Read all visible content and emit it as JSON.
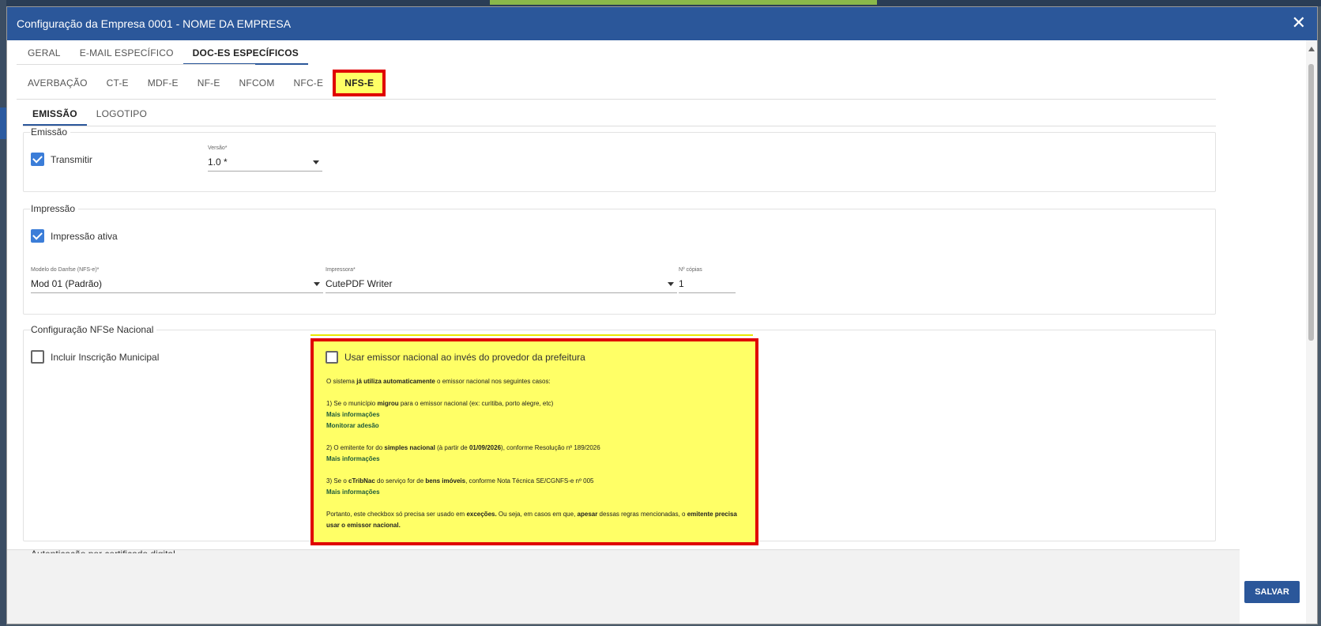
{
  "dialog": {
    "title": "Configuração da Empresa 0001 - NOME DA EMPRESA",
    "close_label": "✕"
  },
  "tabs_main": [
    "GERAL",
    "E-MAIL ESPECÍFICO",
    "DOC-ES ESPECÍFICOS"
  ],
  "tabs_doc": [
    "AVERBAÇÃO",
    "CT-E",
    "MDF-E",
    "NF-E",
    "NFCOM",
    "NFC-E",
    "NFS-E"
  ],
  "tabs_sub": [
    "EMISSÃO",
    "LOGOTIPO"
  ],
  "emissao": {
    "legend": "Emissão",
    "transmitir_label": "Transmitir",
    "transmitir_checked": true,
    "versao_label": "Versão*",
    "versao_value": "1.0 *"
  },
  "impressao": {
    "legend": "Impressão",
    "ativa_label": "Impressão ativa",
    "ativa_checked": true,
    "modelo_label": "Modelo do Danfse (NFS-e)*",
    "modelo_value": "Mod 01 (Padrão)",
    "impressora_label": "Impressora*",
    "impressora_value": "CutePDF Writer",
    "copias_label": "Nº cópias",
    "copias_value": "1"
  },
  "nacional": {
    "legend": "Configuração NFSe Nacional",
    "incluir_label": "Incluir Inscrição Municipal",
    "incluir_checked": false,
    "usar_label": "Usar emissor nacional ao invés do provedor da prefeitura",
    "usar_checked": false,
    "intro_a": "O sistema ",
    "intro_b": "já utiliza automaticamente",
    "intro_c": " o emissor nacional nos seguintes casos:",
    "c1_a": "1) Se o município ",
    "c1_b": "migrou",
    "c1_c": " para o emissor nacional (ex: curitiba, porto alegre, etc)",
    "c1_link1": "Mais informações",
    "c1_link2": "Monitorar adesão",
    "c2_a": "2) O emitente for do ",
    "c2_b": "simples nacional",
    "c2_c": " (à partir de ",
    "c2_d": "01/09/2026",
    "c2_e": "), conforme Resolução nº 189/2026",
    "c2_link": "Mais informações",
    "c3_a": "3) Se o ",
    "c3_b": "cTribNac",
    "c3_c": " do serviço for de ",
    "c3_d": "bens imóveis",
    "c3_e": ", conforme Nota Técnica SE/CGNFS-e nº 005",
    "c3_link": "Mais informações",
    "end_a": "Portanto, este checkbox só precisa ser usado em ",
    "end_b": "exceções.",
    "end_c": " Ou seja, em casos em que, ",
    "end_d": "apesar",
    "end_e": " dessas regras mencionadas, o ",
    "end_f": "emitente precisa usar o emissor nacional."
  },
  "cut_section_label": "Autenticação por certificado digital",
  "save_label": "SALVAR",
  "colors": {
    "header": "#2b579a",
    "highlight": "#ffff66",
    "highlight_border": "#e00000",
    "checkbox": "#3b7dd8"
  }
}
